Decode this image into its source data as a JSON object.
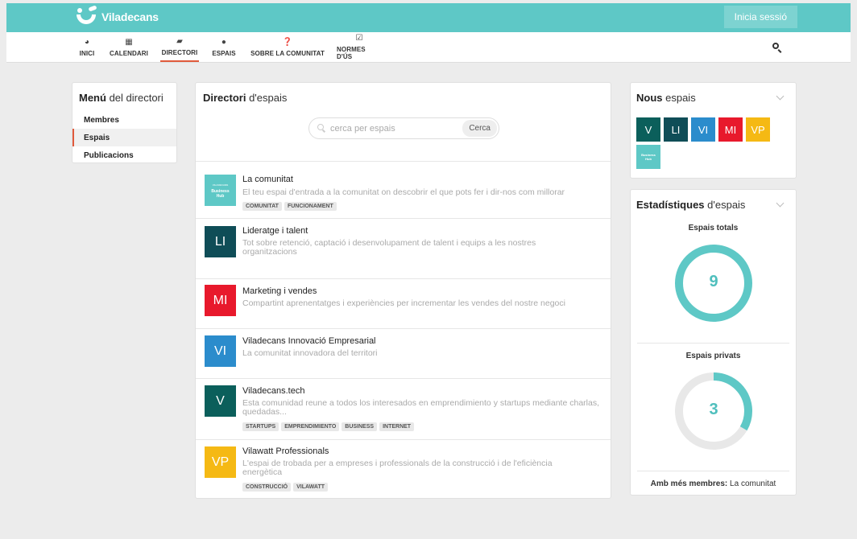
{
  "brand": {
    "name": "Viladecans",
    "color": "#5ec8c6"
  },
  "header": {
    "login_label": "Inicia sessió"
  },
  "nav": {
    "items": [
      {
        "label": "INICI",
        "icon": "dashboard-icon"
      },
      {
        "label": "CALENDARI",
        "icon": "calendar-icon"
      },
      {
        "label": "DIRECTORI",
        "icon": "book-icon"
      },
      {
        "label": "ESPAIS",
        "icon": "compass-icon"
      },
      {
        "label": "SOBRE LA COMUNITAT",
        "icon": "question-icon"
      },
      {
        "label": "NORMES D'ÚS",
        "icon": "checkbox-icon"
      }
    ],
    "active": "DIRECTORI"
  },
  "menu": {
    "title_bold": "Menú",
    "title_rest": " del directori",
    "items": [
      "Membres",
      "Espais",
      "Publicacions"
    ],
    "active": "Espais"
  },
  "directory": {
    "title_bold": "Directori",
    "title_rest": " d'espais",
    "search_placeholder": "cerca per espais",
    "search_button": "Cerca",
    "spaces": [
      {
        "initials": "Business Hub",
        "logo_top": "VILADECANS",
        "color": "#5ec8c6",
        "name": "La comunitat",
        "description": "El teu espai d'entrada a la comunitat on descobrir el que pots fer i dir-nos com millorar",
        "tags": [
          "COMUNITAT",
          "FUNCIONAMENT"
        ]
      },
      {
        "initials": "LI",
        "color": "#0f4d57",
        "name": "Lideratge i talent",
        "description": "Tot sobre retenció, captació i desenvolupament de talent i equips a les nostres organitzacions",
        "tags": []
      },
      {
        "initials": "MI",
        "color": "#e8192c",
        "name": "Marketing i vendes",
        "description": "Compartint aprenentatges i experiències per incrementar les vendes del nostre negoci",
        "tags": []
      },
      {
        "initials": "VI",
        "color": "#2b8ccc",
        "name": "Viladecans Innovació Empresarial",
        "description": "La comunitat innovadora del territori",
        "tags": []
      },
      {
        "initials": "V",
        "color": "#0b5f5b",
        "name": "Viladecans.tech",
        "description": "Esta comunidad reune a todos los interesados en emprendimiento y startups mediante charlas, quedadas...",
        "tags": [
          "STARTUPS",
          "EMPRENDIMIENTO",
          "BUSINESS",
          "INTERNET"
        ]
      },
      {
        "initials": "VP",
        "color": "#f5b914",
        "name": "Vilawatt Professionals",
        "description": "L'espai de trobada per a empreses i professionals de la construcció i de l'eficiència energètica",
        "tags": [
          "CONSTRUCCIÓ",
          "VILAWATT"
        ]
      }
    ]
  },
  "new_spaces": {
    "title_bold": "Nous",
    "title_rest": " espais",
    "items": [
      {
        "initials": "V",
        "color": "#0b5f5b"
      },
      {
        "initials": "LI",
        "color": "#0f4d57"
      },
      {
        "initials": "VI",
        "color": "#2b8ccc"
      },
      {
        "initials": "MI",
        "color": "#e8192c"
      },
      {
        "initials": "VP",
        "color": "#f5b914"
      },
      {
        "initials": "Business Hub",
        "color": "#5ec8c6"
      }
    ]
  },
  "stats": {
    "title_bold": "Estadístiques",
    "title_rest": " d'espais",
    "total_label": "Espais totals",
    "total_value": "9",
    "private_label": "Espais privats",
    "private_value": "3",
    "private_fraction": 0.3333,
    "footer_label": "Amb més membres:",
    "footer_value": " La comunitat",
    "ring_color": "#5ec8c6",
    "ring_track": "#e8e8e8"
  }
}
